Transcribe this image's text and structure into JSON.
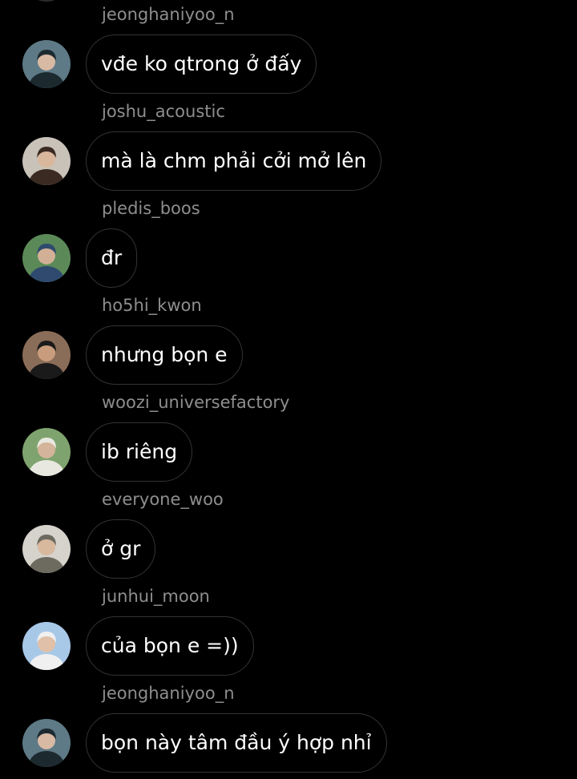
{
  "conversation": {
    "messages": [
      {
        "sender": "jeonghaniyoo_n",
        "text": "vđe ko qtrong ở đấy",
        "avatar_icon": "profile-photo-man-dark-hair",
        "avatar_colors": [
          "#5e7a86",
          "#1c2a30",
          "#d8b9a4"
        ]
      },
      {
        "sender": "joshu_acoustic",
        "text": "mà là chm phải cởi mở lên",
        "avatar_icon": "profile-photo-man-dark-hair",
        "avatar_colors": [
          "#c9c2b8",
          "#3a2a22",
          "#d9b79c"
        ]
      },
      {
        "sender": "pledis_boos",
        "text": "đr",
        "avatar_icon": "profile-photo-man-outdoors",
        "avatar_colors": [
          "#5b8a58",
          "#2f4a6e",
          "#d1b096"
        ]
      },
      {
        "sender": "ho5hi_kwon",
        "text": "nhưng bọn e",
        "avatar_icon": "profile-photo-man-cap",
        "avatar_colors": [
          "#8a6d58",
          "#1a1a1a",
          "#c89c7d"
        ]
      },
      {
        "sender": "woozi_universefactory",
        "text": "ib riêng",
        "avatar_icon": "profile-photo-man-outdoors",
        "avatar_colors": [
          "#7fa36e",
          "#e8e8e0",
          "#d4b49a"
        ]
      },
      {
        "sender": "everyone_woo",
        "text": "ở gr",
        "avatar_icon": "profile-photo-man-light",
        "avatar_colors": [
          "#d6d2cc",
          "#6d6a60",
          "#d8b99e"
        ]
      },
      {
        "sender": "junhui_moon",
        "text": "của bọn e =))",
        "avatar_icon": "profile-photo-man-bucket-hat",
        "avatar_colors": [
          "#a8c8e8",
          "#f0f0f0",
          "#e0c0a8"
        ]
      },
      {
        "sender": "jeonghaniyoo_n",
        "text": "bọn này tâm đầu ý hợp nhỉ",
        "avatar_icon": "profile-photo-man-dark-hair",
        "avatar_colors": [
          "#5e7a86",
          "#1c2a30",
          "#d8b9a4"
        ]
      }
    ]
  }
}
